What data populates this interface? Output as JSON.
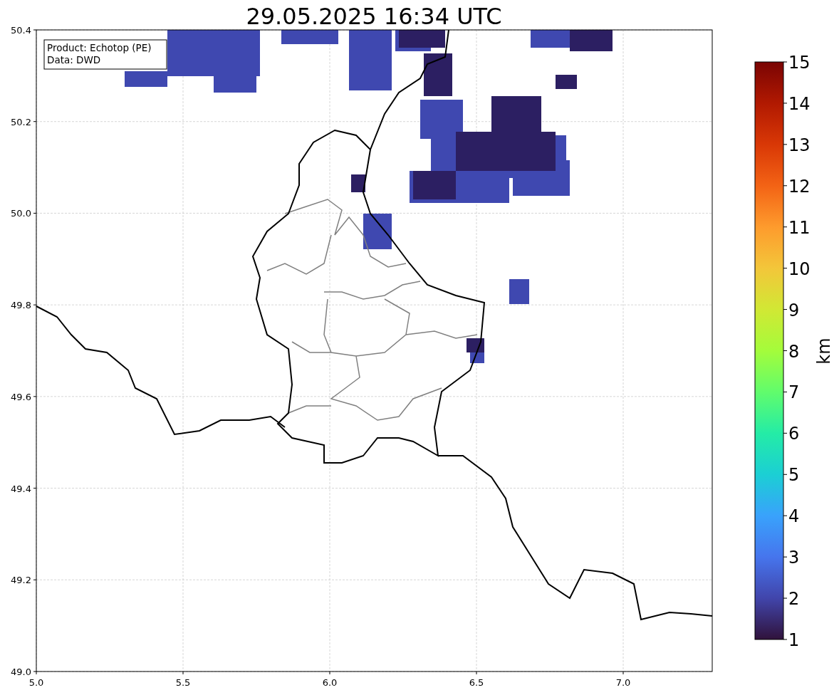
{
  "title": "29.05.2025 16:34 UTC",
  "legend": [
    "Product: Echotop (PE)",
    "Data: DWD"
  ],
  "map": {
    "x_ticks": [
      "5.0",
      "5.5",
      "6.0",
      "6.5",
      "7.0"
    ],
    "y_ticks": [
      "50.4",
      "50.2",
      "50.0",
      "49.8",
      "49.6",
      "49.4",
      "49.2",
      "49.0"
    ]
  },
  "colorbar": {
    "ticks": [
      "15",
      "14",
      "13",
      "12",
      "11",
      "10",
      "9",
      "8",
      "7",
      "6",
      "5",
      "4",
      "3",
      "2",
      "1"
    ],
    "label": "km"
  }
}
